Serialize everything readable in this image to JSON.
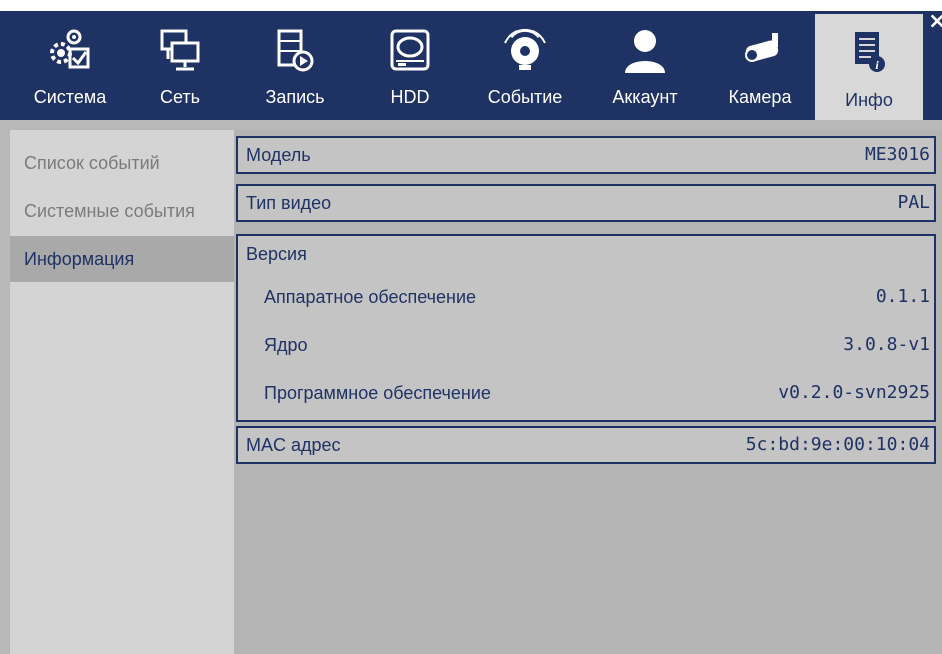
{
  "tabs": [
    {
      "label": "Система",
      "icon": "gears-check-icon"
    },
    {
      "label": "Сеть",
      "icon": "network-computers-icon"
    },
    {
      "label": "Запись",
      "icon": "film-record-icon"
    },
    {
      "label": "HDD",
      "icon": "hard-disk-icon"
    },
    {
      "label": "Событие",
      "icon": "alarm-bell-icon"
    },
    {
      "label": "Аккаунт",
      "icon": "user-account-icon"
    },
    {
      "label": "Камера",
      "icon": "camera-icon"
    },
    {
      "label": "Инфо",
      "icon": "info-document-icon"
    }
  ],
  "active_tab": "Инфо",
  "close_symbol": "×",
  "sidebar": {
    "items": [
      {
        "label": "Список событий"
      },
      {
        "label": "Системные события"
      },
      {
        "label": "Информация"
      }
    ],
    "active": "Информация"
  },
  "info": {
    "model": {
      "label": "Модель",
      "value": "ME3016"
    },
    "video_type": {
      "label": "Тип видео",
      "value": "PAL"
    },
    "version": {
      "title": "Версия",
      "hardware": {
        "label": "Аппаратное обеспечение",
        "value": "0.1.1"
      },
      "kernel": {
        "label": "Ядро",
        "value": "3.0.8-v1"
      },
      "software": {
        "label": "Программное обеспечение",
        "value": "v0.2.0-svn2925"
      }
    },
    "mac": {
      "label": "MAC адрес",
      "value": "5c:bd:9e:00:10:04"
    }
  },
  "colors": {
    "header": "#1f3264",
    "accent": "#1f3264",
    "panel": "#b4b4b4",
    "sidebar": "#d4d4d4",
    "active_tab": "#d8d8d8"
  }
}
